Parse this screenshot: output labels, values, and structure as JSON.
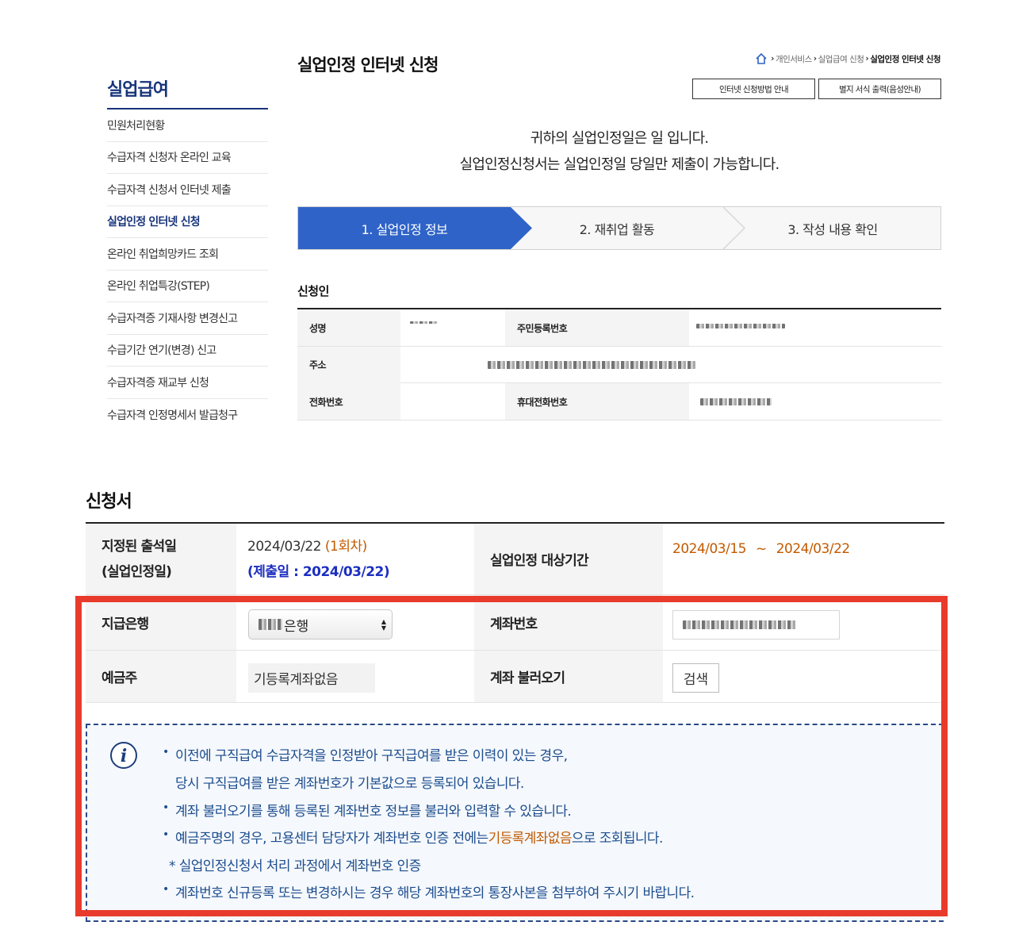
{
  "sidebar": {
    "title": "실업급여",
    "items": [
      {
        "label": "민원처리현황",
        "active": false
      },
      {
        "label": "수급자격 신청자 온라인 교육",
        "active": false
      },
      {
        "label": "수급자격 신청서 인터넷 제출",
        "active": false
      },
      {
        "label": "실업인정 인터넷 신청",
        "active": true
      },
      {
        "label": "온라인 취업희망카드 조회",
        "active": false
      },
      {
        "label": "온라인 취업특강(STEP)",
        "active": false
      },
      {
        "label": "수급자격증 기재사항 변경신고",
        "active": false
      },
      {
        "label": "수급기간 연기(변경) 신고",
        "active": false
      },
      {
        "label": "수급자격증 재교부 신청",
        "active": false
      },
      {
        "label": "수급자격 인정명세서 발급청구",
        "active": false
      }
    ]
  },
  "header": {
    "title": "실업인정 인터넷 신청",
    "breadcrumb": [
      "개인서비스",
      "실업급여 신청",
      "실업인정 인터넷 신청"
    ],
    "buttons": [
      "인터넷 신청방법 안내",
      "별지 서식 출력(음성안내)"
    ]
  },
  "notice": {
    "line1": "귀하의 실업인정일은 일 입니다.",
    "line2": "실업인정신청서는 실업인정일 당일만 제출이 가능합니다."
  },
  "steps": [
    {
      "label": "1. 실업인정 정보",
      "active": true
    },
    {
      "label": "2. 재취업 활동",
      "active": false
    },
    {
      "label": "3. 작성 내용 확인",
      "active": false
    }
  ],
  "applicant": {
    "title": "신청인",
    "name_label": "성명",
    "rrn_label": "주민등록번호",
    "address_label": "주소",
    "phone_label": "전화번호",
    "mobile_label": "휴대전화번호"
  },
  "form": {
    "title": "신청서",
    "attendance_label_1": "지정된 출석일",
    "attendance_label_2": "(실업인정일)",
    "attendance_date": "2024/03/22",
    "attendance_round": "(1회차)",
    "submit_date": "(제출일 : 2024/03/22)",
    "period_label": "실업인정 대상기간",
    "period_start": "2024/03/15",
    "period_sep": "~",
    "period_end": "2024/03/22",
    "bank_label": "지급은행",
    "bank_value_suffix": "은행",
    "account_label": "계좌번호",
    "holder_label": "예금주",
    "holder_value": "기등록계좌없음",
    "load_label": "계좌 불러오기",
    "search_button": "검색"
  },
  "info": {
    "line1": "이전에 구직급여 수급자격을 인정받아 구직급여를 받은 이력이 있는 경우,",
    "line1b": "당시 구직급여를 받은 계좌번호가 기본값으로 등록되어 있습니다.",
    "line2": "계좌 불러오기를 통해 등록된 계좌번호 정보를 불러와 입력할 수 있습니다.",
    "line3_pre": "예금주명의 경우, 고용센터 담당자가 계좌번호 인증 전에는 ",
    "line3_highlight": "기등록계좌없음",
    "line3_post": "으로 조회됩니다.",
    "line4": "* 실업인정신청서 처리 과정에서 계좌번호 인증",
    "line5": "계좌번호 신규등록 또는 변경하시는 경우 해당 계좌번호의 통장사본을 첨부하여 주시기 바랍니다."
  },
  "colors": {
    "accent": "#2f63c7",
    "nav_dark": "#17337a",
    "highlight_box": "#e83b2c",
    "info_text": "#1c4d8e",
    "orange_text": "#c25a00"
  }
}
